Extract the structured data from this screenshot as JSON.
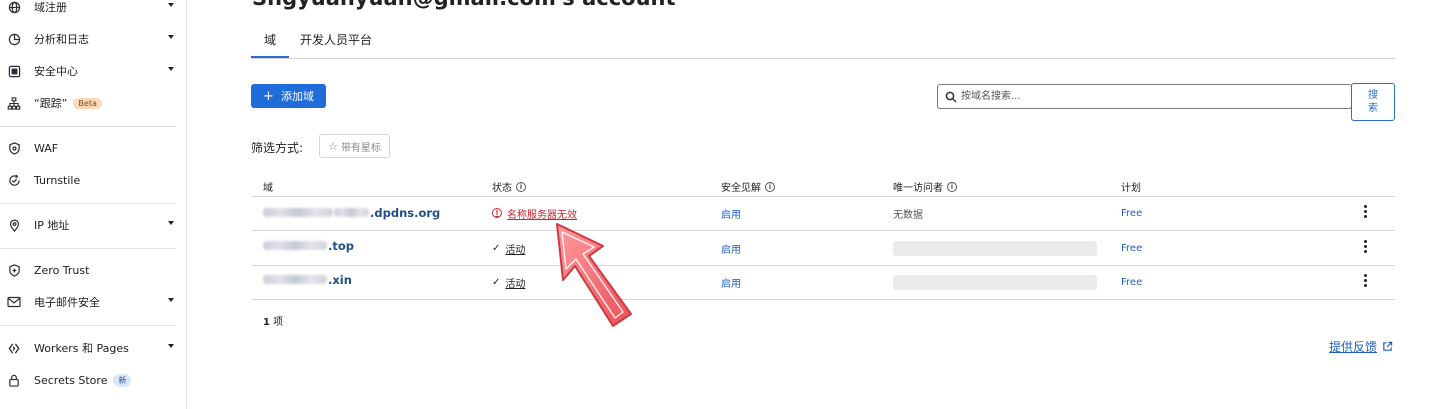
{
  "sidebar": {
    "items": [
      {
        "label": "域注册",
        "icon": "globe-icon",
        "expandable": true
      },
      {
        "label": "分析和日志",
        "icon": "pie-chart-icon",
        "expandable": true
      },
      {
        "label": "安全中心",
        "icon": "security-center-icon",
        "expandable": true
      },
      {
        "label": "“跟踪”",
        "icon": "sitemap-icon",
        "badge": "Beta"
      },
      {
        "label": "WAF",
        "icon": "waf-shield-icon"
      },
      {
        "label": "Turnstile",
        "icon": "turnstile-icon"
      },
      {
        "label": "IP 地址",
        "icon": "location-pin-icon",
        "expandable": true
      },
      {
        "label": "Zero Trust",
        "icon": "zero-trust-icon"
      },
      {
        "label": "电子邮件安全",
        "icon": "envelope-icon",
        "expandable": true
      },
      {
        "label": "Workers 和 Pages",
        "icon": "workers-icon",
        "expandable": true
      },
      {
        "label": "Secrets Store",
        "icon": "lock-icon",
        "badge": "新"
      }
    ]
  },
  "header": {
    "title": "Shgyuanyuan@gmail.com's account"
  },
  "tabs": [
    {
      "label": "域",
      "active": true
    },
    {
      "label": "开发人员平台",
      "active": false
    }
  ],
  "toolbar": {
    "add_label": "添加域",
    "search_placeholder": "按域名搜索...",
    "search_button": "搜索",
    "filter_label": "筛选方式:",
    "starred_label": "带有星标"
  },
  "table": {
    "columns": [
      {
        "label": "域",
        "info": false
      },
      {
        "label": "状态",
        "info": true
      },
      {
        "label": "安全见解",
        "info": true
      },
      {
        "label": "唯一访问者",
        "info": true
      },
      {
        "label": "计划",
        "info": false
      }
    ],
    "rows": [
      {
        "domain_suffix": ".dpdns.org",
        "status": "名称服务器无效",
        "status_type": "error",
        "insights": "启用",
        "visitors": "无数据",
        "plan": "Free"
      },
      {
        "domain_suffix": ".top",
        "status": "活动",
        "status_type": "ok",
        "insights": "启用",
        "visitors": "",
        "plan": "Free"
      },
      {
        "domain_suffix": ".xin",
        "status": "活动",
        "status_type": "ok",
        "insights": "启用",
        "visitors": "",
        "plan": "Free"
      }
    ],
    "count_number": "1",
    "count_unit": "项"
  },
  "feedback_label": "提供反馈",
  "colors": {
    "accent": "#1f6ddb",
    "link": "#1f5fc0",
    "error": "#c8262f",
    "annotation_arrow": "#e8323c"
  }
}
